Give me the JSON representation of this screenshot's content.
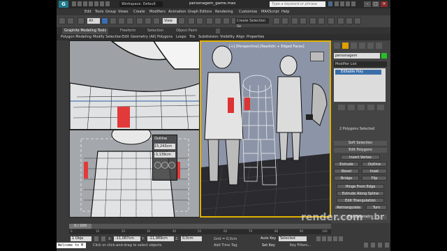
{
  "app": {
    "logo_text": "G",
    "workspace": "Workspace: Default",
    "title": "personagem_game.max",
    "search_placeholder": "Type a keyword or phrase"
  },
  "menu": [
    "Edit",
    "Tools",
    "Group",
    "Views",
    "Create",
    "Modifiers",
    "Animation",
    "Graph Editors",
    "Rendering",
    "Customize",
    "MAXScript",
    "Help"
  ],
  "toolbar": {
    "filter_all": "All",
    "view_dropdown": "View",
    "selection_set_placeholder": "Create Selection Se"
  },
  "ribbon": {
    "tabs": [
      "Graphite Modeling Tools",
      "Freeform",
      "Selection",
      "Object Paint"
    ],
    "panels": [
      "Polygon Modeling",
      "Modify Selection",
      "Edit",
      "Geometry (All)",
      "Polygons",
      "Loops",
      "Tris",
      "Subdivision",
      "Visibility",
      "Align",
      "Properties"
    ]
  },
  "viewports": {
    "perspective_label": "[+] [Perspective] [Realistic + Edged Faces]",
    "caddy_title": "Outline",
    "caddy_value1": "15,243cm",
    "caddy_value2": "-3,139cm"
  },
  "command_panel": {
    "object_name": "personagem",
    "object_color": "#22c022",
    "modifier_list": "Modifier List",
    "stack_item": "Editable Poly",
    "selection_status": "2 Polygons Selected",
    "soft_selection": "Soft Selection",
    "edit_polygons": "Edit Polygons",
    "insert_vertex": "Insert Vertex",
    "extrude": "Extrude",
    "outline": "Outline",
    "bevel": "Bevel",
    "inset": "Inset",
    "bridge": "Bridge",
    "flip": "Flip",
    "hinge_from_edge": "Hinge From Edge",
    "extrude_along_spline": "Extrude Along Spline",
    "edit_triangulation": "Edit Triangulation",
    "retriangulate": "Retriangulate",
    "turn": "Turn",
    "edit_geometry": "Edit Geometry"
  },
  "timeline": {
    "frame_counter": "0 / 100",
    "ticks": [
      "0",
      "10",
      "20",
      "30",
      "40",
      "50",
      "60",
      "70",
      "80",
      "90",
      "100"
    ]
  },
  "status_bar": {
    "selection": "1 Obje",
    "x": "-11,087cm",
    "y": "-11,989cm",
    "z": "0,0cm",
    "grid": "Grid = 0,0cm",
    "auto_key": "Auto Key",
    "set_key": "Set Key",
    "key_mode": "Selected",
    "key_filters": "Key Filters...",
    "prompt": "Click or click-and-drag to select objects",
    "add_time_tag": "Add Time Tag",
    "maxscript_listener": "Welcome to M"
  },
  "watermark": {
    "brand": "render.com",
    "tld": ".br"
  }
}
